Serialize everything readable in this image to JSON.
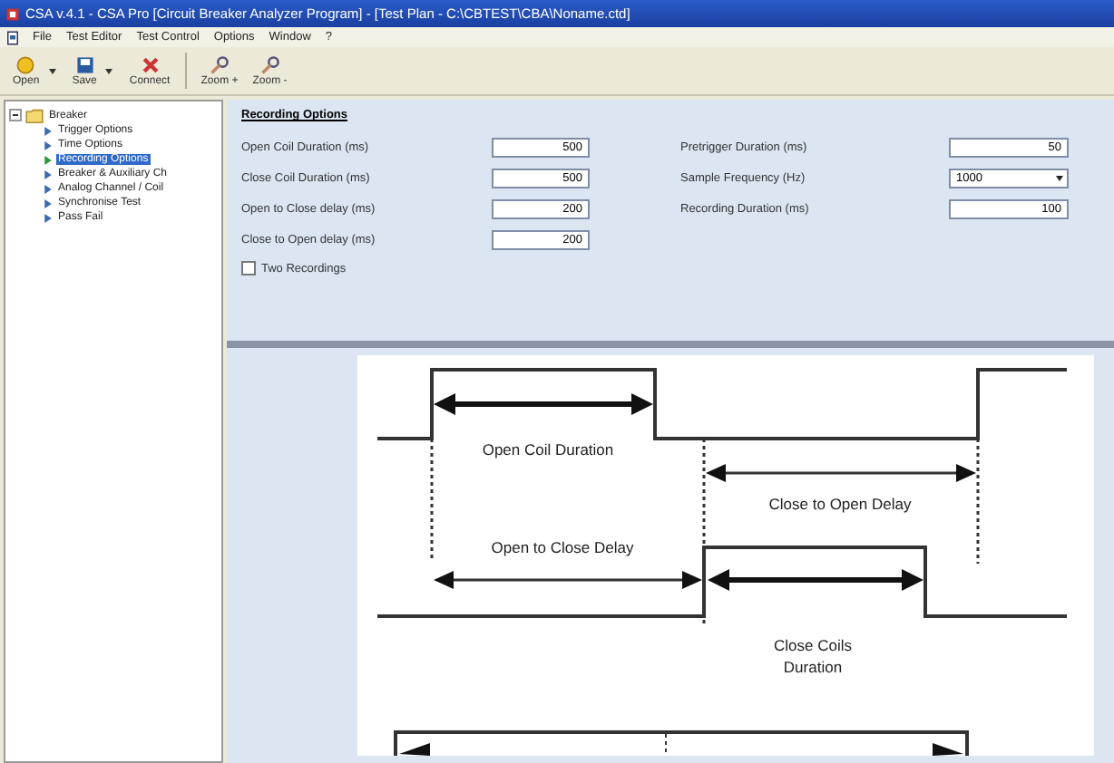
{
  "window": {
    "title": "CSA v.4.1 - CSA Pro [Circuit Breaker Analyzer Program] - [Test Plan - C:\\CBTEST\\CBA\\Noname.ctd]"
  },
  "menu": [
    "File",
    "Test Editor",
    "Test Control",
    "Options",
    "Window",
    "?"
  ],
  "toolbar": [
    {
      "label": "Open",
      "kind": "open",
      "dropdown": true
    },
    {
      "label": "Save",
      "kind": "save",
      "dropdown": true
    },
    {
      "label": "Connect",
      "kind": "connect",
      "dropdown": false
    },
    {
      "label": "Zoom +",
      "kind": "zoom",
      "dropdown": false
    },
    {
      "label": "Zoom -",
      "kind": "zoom",
      "dropdown": false
    }
  ],
  "tree": {
    "label": "Breaker",
    "expanded": true,
    "children": [
      {
        "label": "Trigger Options",
        "selected": false
      },
      {
        "label": "Time Options",
        "selected": false
      },
      {
        "label": "Recording Options",
        "selected": true
      },
      {
        "label": "Breaker & Auxiliary Ch",
        "selected": false
      },
      {
        "label": "Analog Channel / Coil",
        "selected": false
      },
      {
        "label": "Synchronise Test",
        "selected": false
      },
      {
        "label": "Pass Fail",
        "selected": false
      }
    ]
  },
  "form": {
    "title": "Recording Options",
    "left": [
      {
        "label": "Open Coil Duration (ms)",
        "value": "500"
      },
      {
        "label": "Close Coil Duration (ms)",
        "value": "500"
      },
      {
        "label": "Open to Close delay (ms)",
        "value": "200"
      },
      {
        "label": "Close to Open delay (ms)",
        "value": "200"
      }
    ],
    "right": [
      {
        "label": "Pretrigger Duration (ms)",
        "value": "50",
        "kind": "text"
      },
      {
        "label": "Sample Frequency (Hz)",
        "value": "1000",
        "kind": "select"
      },
      {
        "label": "Recording Duration (ms)",
        "value": "100",
        "kind": "text"
      }
    ],
    "checkbox": {
      "label": "Two Recordings",
      "checked": false
    }
  },
  "diagram": {
    "open_coil": "Open Coil Duration",
    "close_to_open": "Close to Open Delay",
    "open_to_close": "Open to Close Delay",
    "close_coils": [
      "Close Coils",
      "Duration"
    ]
  }
}
